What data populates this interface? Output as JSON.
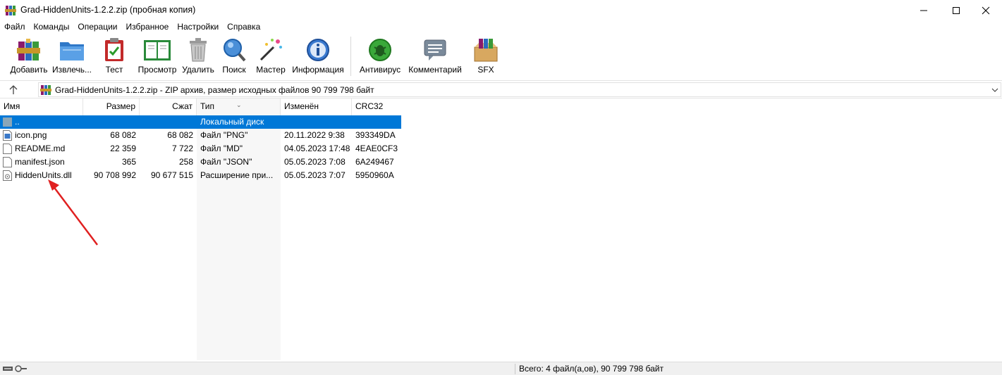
{
  "window": {
    "title": "Grad-HiddenUnits-1.2.2.zip (пробная копия)",
    "app_icon": "winrar-icon"
  },
  "menu": [
    "Файл",
    "Команды",
    "Операции",
    "Избранное",
    "Настройки",
    "Справка"
  ],
  "toolbar": [
    {
      "label": "Добавить",
      "icon": "add-archive-icon"
    },
    {
      "label": "Извлечь...",
      "icon": "extract-folder-icon"
    },
    {
      "label": "Тест",
      "icon": "test-clipboard-icon"
    },
    {
      "label": "Просмотр",
      "icon": "view-book-icon"
    },
    {
      "label": "Удалить",
      "icon": "trash-icon"
    },
    {
      "label": "Поиск",
      "icon": "search-icon"
    },
    {
      "label": "Мастер",
      "icon": "wizard-wand-icon"
    },
    {
      "label": "Информация",
      "icon": "info-icon"
    },
    {
      "label": "Антивирус",
      "icon": "antivirus-bug-icon"
    },
    {
      "label": "Комментарий",
      "icon": "comment-icon"
    },
    {
      "label": "SFX",
      "icon": "sfx-box-icon"
    }
  ],
  "address": {
    "text": "Grad-HiddenUnits-1.2.2.zip - ZIP архив, размер исходных файлов 90 799 798 байт"
  },
  "columns": [
    "Имя",
    "Размер",
    "Сжат",
    "Тип",
    "Изменён",
    "CRC32"
  ],
  "rows": [
    {
      "name": "..",
      "size": "",
      "packed": "",
      "type": "Локальный диск",
      "modified": "",
      "crc": "",
      "icon": "parent-folder-icon",
      "selected": true
    },
    {
      "name": "icon.png",
      "size": "68 082",
      "packed": "68 082",
      "type": "Файл \"PNG\"",
      "modified": "20.11.2022 9:38",
      "crc": "393349DA",
      "icon": "image-file-icon",
      "selected": false
    },
    {
      "name": "README.md",
      "size": "22 359",
      "packed": "7 722",
      "type": "Файл \"MD\"",
      "modified": "04.05.2023 17:48",
      "crc": "4EAE0CF3",
      "icon": "file-icon",
      "selected": false
    },
    {
      "name": "manifest.json",
      "size": "365",
      "packed": "258",
      "type": "Файл \"JSON\"",
      "modified": "05.05.2023 7:08",
      "crc": "6A249467",
      "icon": "file-icon",
      "selected": false
    },
    {
      "name": "HiddenUnits.dll",
      "size": "90 708 992",
      "packed": "90 677 515",
      "type": "Расширение при...",
      "modified": "05.05.2023 7:07",
      "crc": "5950960A",
      "icon": "dll-file-icon",
      "selected": false
    }
  ],
  "status": {
    "text": "Всего: 4 файл(а,ов), 90 799 798 байт"
  },
  "colors": {
    "selection": "#0078d7",
    "annotation_arrow": "#e02020"
  }
}
